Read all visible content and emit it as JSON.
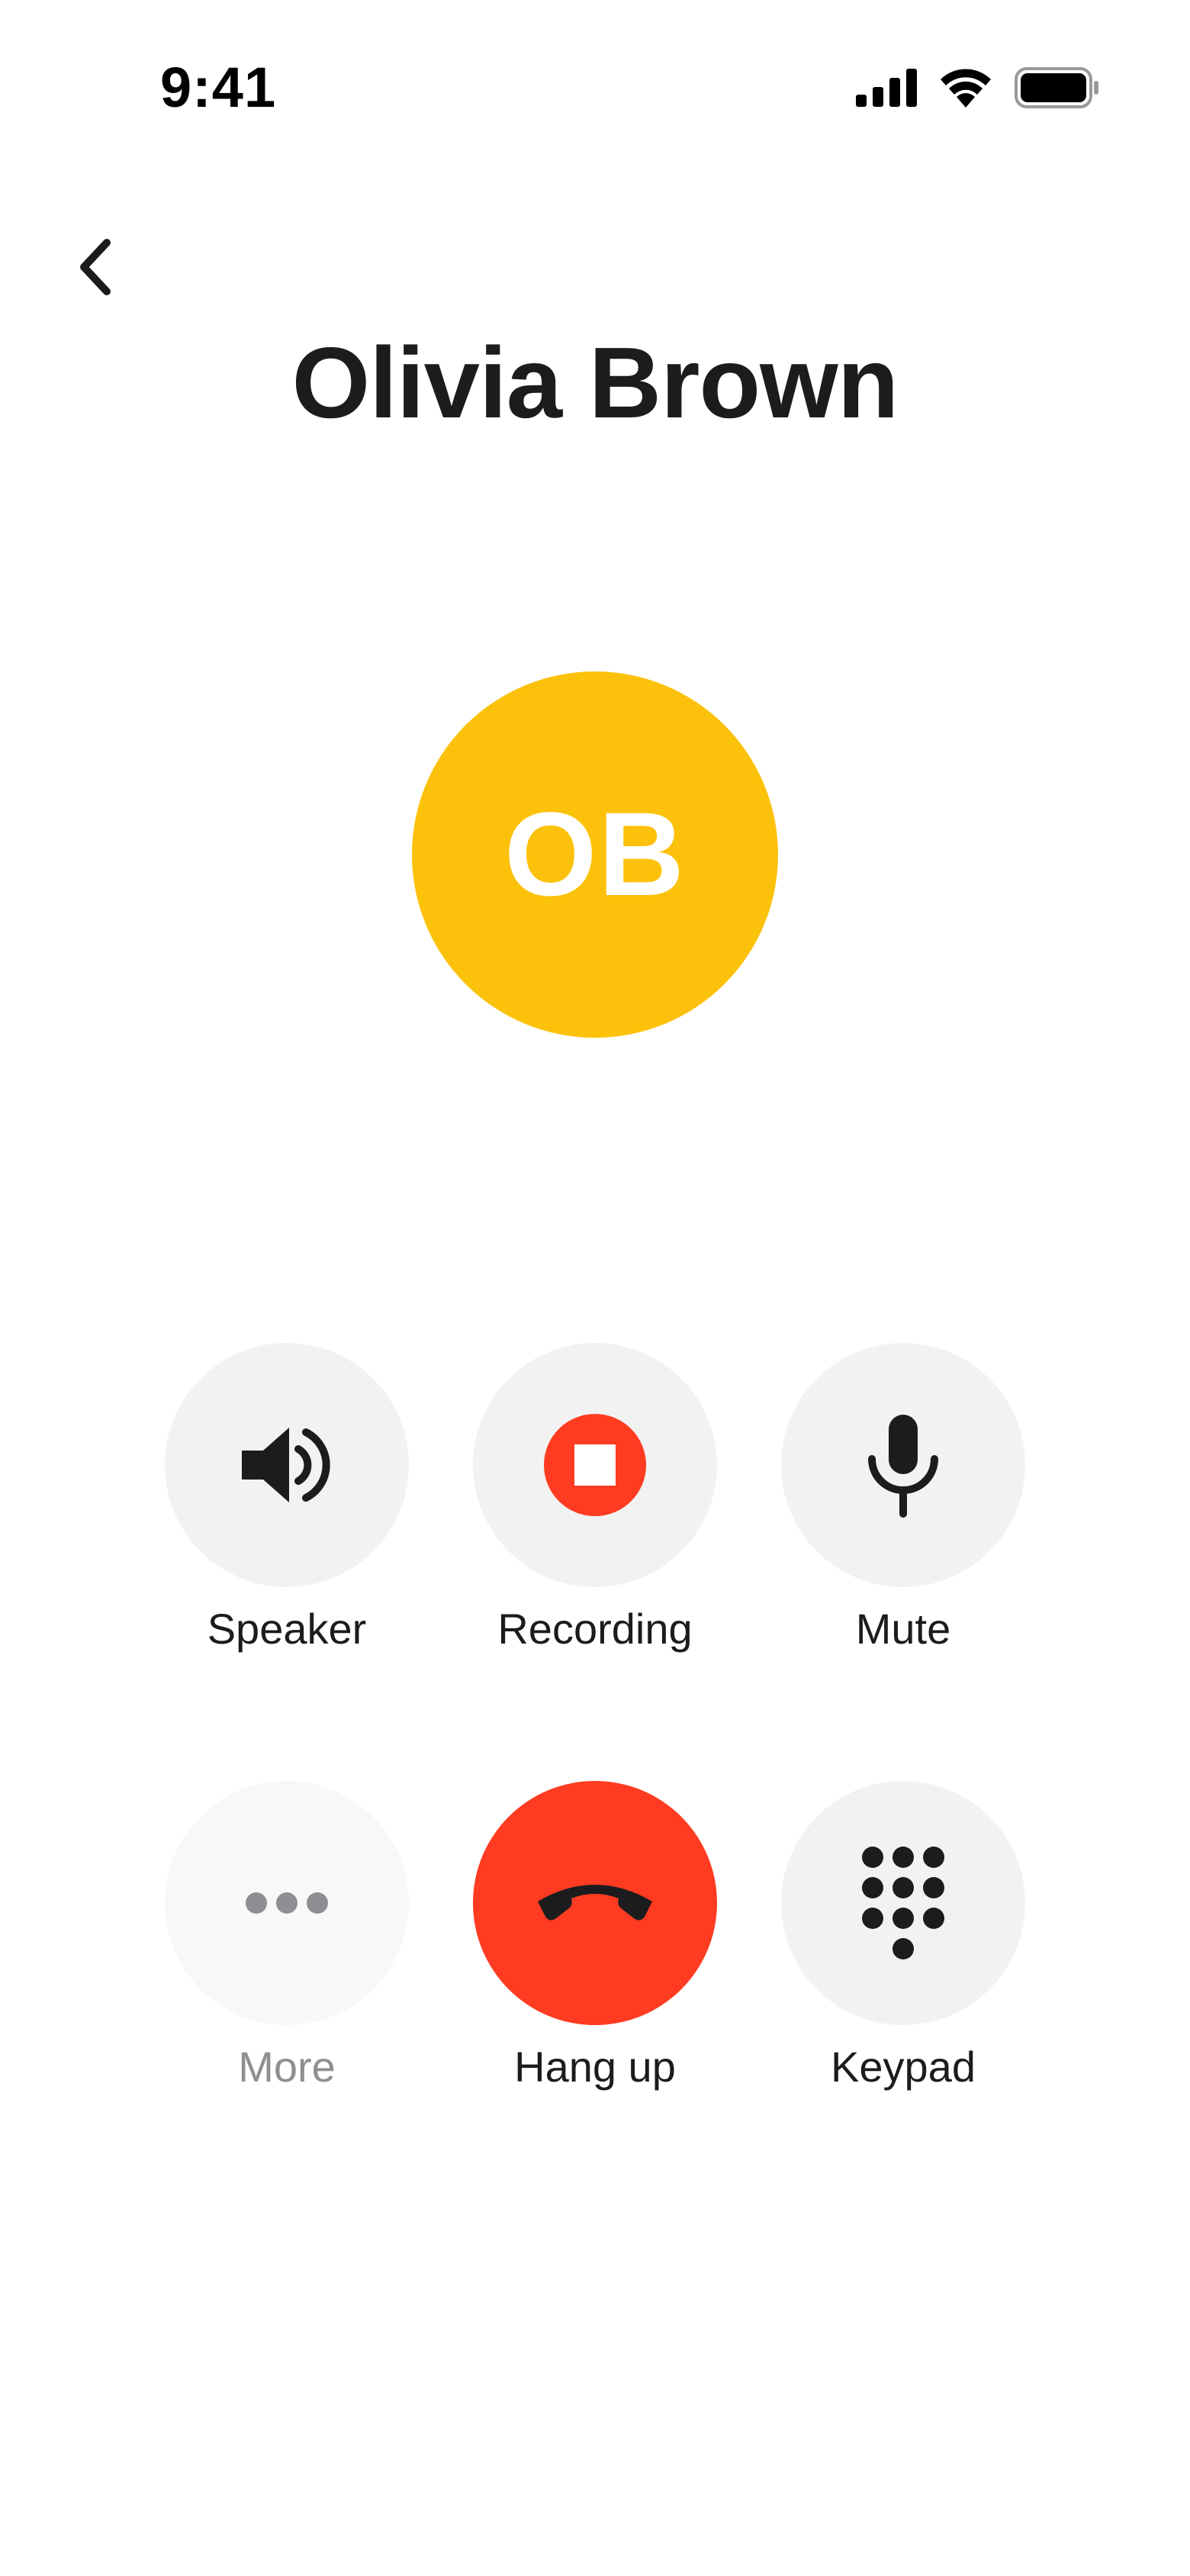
{
  "status_bar": {
    "time": "9:41",
    "icons": [
      "cellular-signal-icon",
      "wifi-icon",
      "battery-icon"
    ]
  },
  "header": {
    "back_icon": "chevron-left-icon"
  },
  "contact": {
    "name": "Olivia Brown",
    "initials": "OB",
    "avatar_color": "#FCC10A"
  },
  "controls": {
    "speaker": {
      "label": "Speaker",
      "icon": "speaker-icon"
    },
    "recording": {
      "label": "Recording",
      "icon": "record-stop-icon",
      "active": true
    },
    "mute": {
      "label": "Mute",
      "icon": "microphone-icon"
    },
    "more": {
      "label": "More",
      "icon": "more-dots-icon",
      "disabled": true
    },
    "hangup": {
      "label": "Hang up",
      "icon": "hang-up-phone-icon"
    },
    "keypad": {
      "label": "Keypad",
      "icon": "keypad-icon"
    }
  },
  "colors": {
    "accent_red": "#FF3B21",
    "control_background": "#F2F2F2",
    "text_primary": "#1C1C1E",
    "text_disabled": "#8E8E93"
  }
}
